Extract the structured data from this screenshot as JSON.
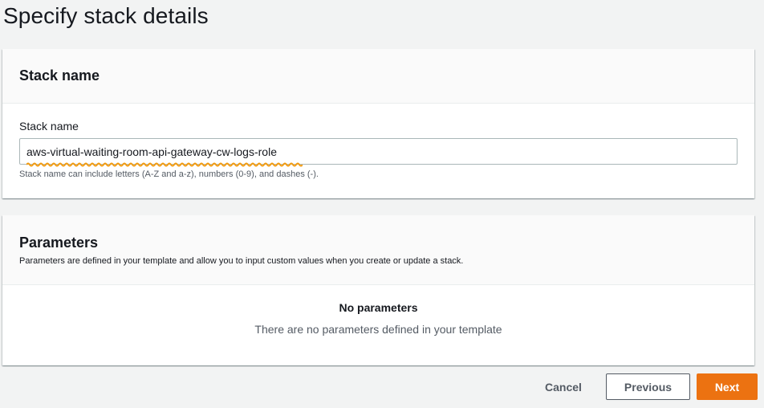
{
  "page": {
    "title": "Specify stack details"
  },
  "stack_name_panel": {
    "heading": "Stack name",
    "field_label": "Stack name",
    "field_value": "aws-virtual-waiting-room-api-gateway-cw-logs-role",
    "constraint_text": "Stack name can include letters (A-Z and a-z), numbers (0-9), and dashes (-)."
  },
  "parameters_panel": {
    "heading": "Parameters",
    "description": "Parameters are defined in your template and allow you to input custom values when you create or update a stack.",
    "empty_title": "No parameters",
    "empty_text": "There are no parameters defined in your template"
  },
  "actions": {
    "cancel_label": "Cancel",
    "previous_label": "Previous",
    "next_label": "Next"
  },
  "colors": {
    "primary_button": "#ec7211",
    "annotation_underline": "#f39c12"
  }
}
